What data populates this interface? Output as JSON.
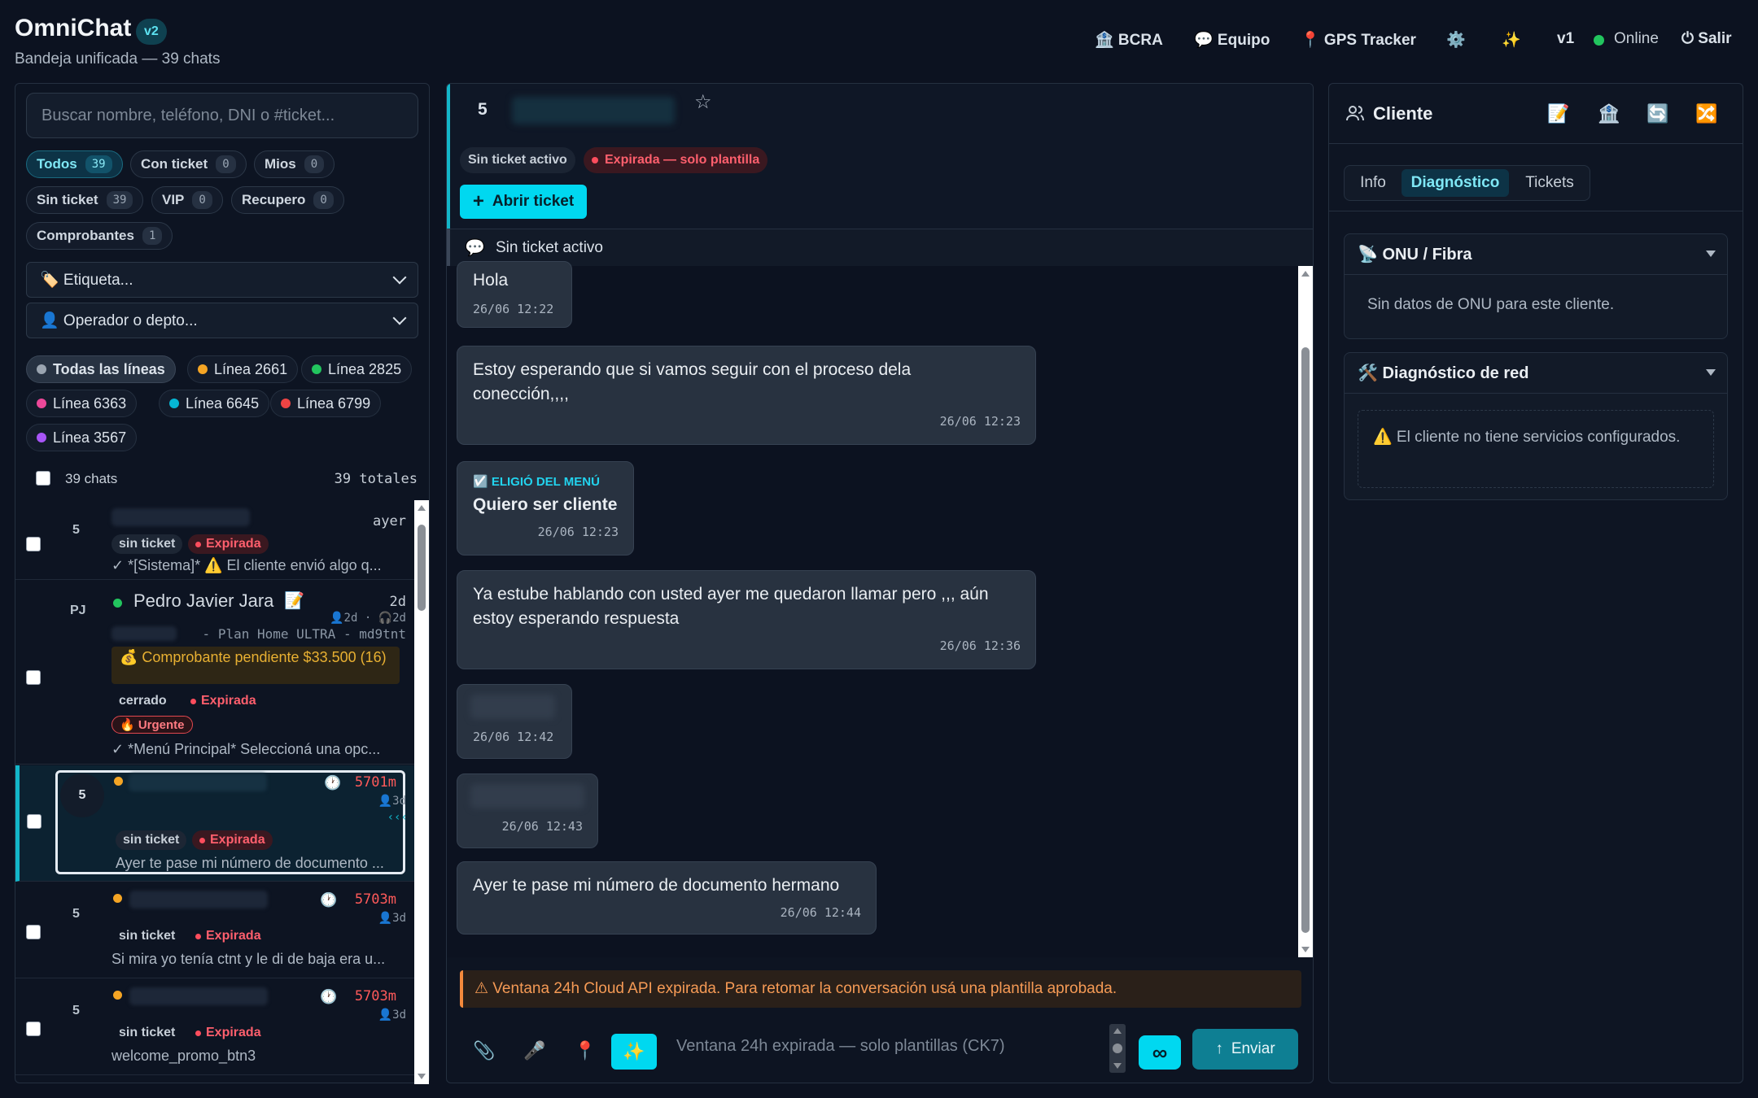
{
  "header": {
    "title": "OmniChat",
    "version_badge": "v2",
    "subtitle": "Bandeja unificada — 39 chats",
    "nav": {
      "bcra": "🏦 BCRA",
      "team": "💬 Equipo",
      "gps": "📍 GPS Tracker",
      "settings": "⚙️",
      "magic": "✨",
      "version": "v1",
      "status": "Online",
      "logout": "⏻ Salir"
    }
  },
  "sidebar": {
    "search_placeholder": "Buscar nombre, teléfono, DNI o #ticket...",
    "filters": [
      {
        "label": "Todos",
        "count": "39"
      },
      {
        "label": "Con ticket",
        "count": "0"
      },
      {
        "label": "Mios",
        "count": "0"
      },
      {
        "label": "Sin ticket",
        "count": "39"
      },
      {
        "label": "VIP",
        "count": "0"
      },
      {
        "label": "Recupero",
        "count": "0"
      },
      {
        "label": "Comprobantes",
        "count": "1"
      }
    ],
    "tag_select": "🏷️ Etiqueta...",
    "operator_select": "👤 Operador o depto...",
    "lines": [
      {
        "label": "Todas las líneas",
        "color": "#9aa4b0"
      },
      {
        "label": "Línea 2661",
        "color": "#f5a524"
      },
      {
        "label": "Línea 2825",
        "color": "#22c55e"
      },
      {
        "label": "Línea 6363",
        "color": "#ec4899"
      },
      {
        "label": "Línea 6645",
        "color": "#06b6d4"
      },
      {
        "label": "Línea 6799",
        "color": "#ef4444"
      },
      {
        "label": "Línea 3567",
        "color": "#a855f7"
      }
    ],
    "chat_count_label": "39 chats",
    "total_label": "39 totales",
    "chats": [
      {
        "avatar": "5",
        "time": "ayer",
        "tag": "sin ticket",
        "status": "Expirada",
        "preview": "✓ *[Sistema]* ⚠️ El cliente envió algo q..."
      },
      {
        "avatar": "PJ",
        "name": "Pedro Javier Jara",
        "name_icon": "📝",
        "time": "2d",
        "meta": "👤2d · 🎧2d",
        "plan": "- Plan Home ULTRA - md9tnt",
        "voucher": "💰 Comprobante pendiente $33.500 (16)",
        "tag": "cerrado",
        "status": "Expirada",
        "urgent": "🔥 Urgente",
        "preview": "✓ *Menú Principal* Seleccioná una opc..."
      },
      {
        "avatar": "5",
        "time": "5701m",
        "meta": "👤3d",
        "tag": "sin ticket",
        "status": "Expirada",
        "preview": "Ayer te pase mi número de documento ..."
      },
      {
        "avatar": "5",
        "time": "5703m",
        "meta": "👤3d",
        "tag": "sin ticket",
        "status": "Expirada",
        "preview": "Si mira yo tenía ctnt y le di de baja era u..."
      },
      {
        "avatar": "5",
        "time": "5703m",
        "meta": "👤3d",
        "tag": "sin ticket",
        "status": "Expirada",
        "preview": "welcome_promo_btn3"
      }
    ]
  },
  "conversation": {
    "avatar": "5",
    "star_icon": "☆",
    "no_ticket_badge": "Sin ticket activo",
    "expired_badge": "Expirada — solo plantilla",
    "open_ticket": "Abrir ticket",
    "ticket_bar": "Sin ticket activo",
    "messages": [
      {
        "text": "Hola",
        "time": "26/06 12:22"
      },
      {
        "text": "Estoy esperando que si vamos seguir con el proceso dela conección,,,,",
        "time": "26/06 12:23"
      },
      {
        "label": "☑️ ELIGIÓ DEL MENÚ",
        "text": "Quiero ser cliente",
        "time": "26/06 12:23"
      },
      {
        "text": "Ya estube hablando con usted ayer me quedaron llamar pero ,,, aún estoy esperando respuesta",
        "time": "26/06 12:36"
      },
      {
        "text": "",
        "time": "26/06 12:42"
      },
      {
        "text": "",
        "time": "26/06 12:43"
      },
      {
        "text": "Ayer te pase mi número de documento hermano",
        "time": "26/06 12:44"
      }
    ],
    "warning": "⚠ Ventana 24h Cloud API expirada. Para retomar la conversación usá una plantilla aprobada.",
    "input_placeholder": "Ventana 24h expirada — solo plantillas (CK7)",
    "send": "Enviar",
    "infinity": "∞"
  },
  "client": {
    "title": "Cliente",
    "tabs": [
      "Info",
      "Diagnóstico",
      "Tickets"
    ],
    "onu_title": "📡 ONU / Fibra",
    "onu_text": "Sin datos de ONU para este cliente.",
    "net_title": "🛠️ Diagnóstico de red",
    "net_text": "⚠️ El cliente no tiene servicios configurados."
  },
  "colors": {
    "accent": "#00d8f0",
    "expired": "#ff5f6d",
    "online": "#22c55e"
  }
}
